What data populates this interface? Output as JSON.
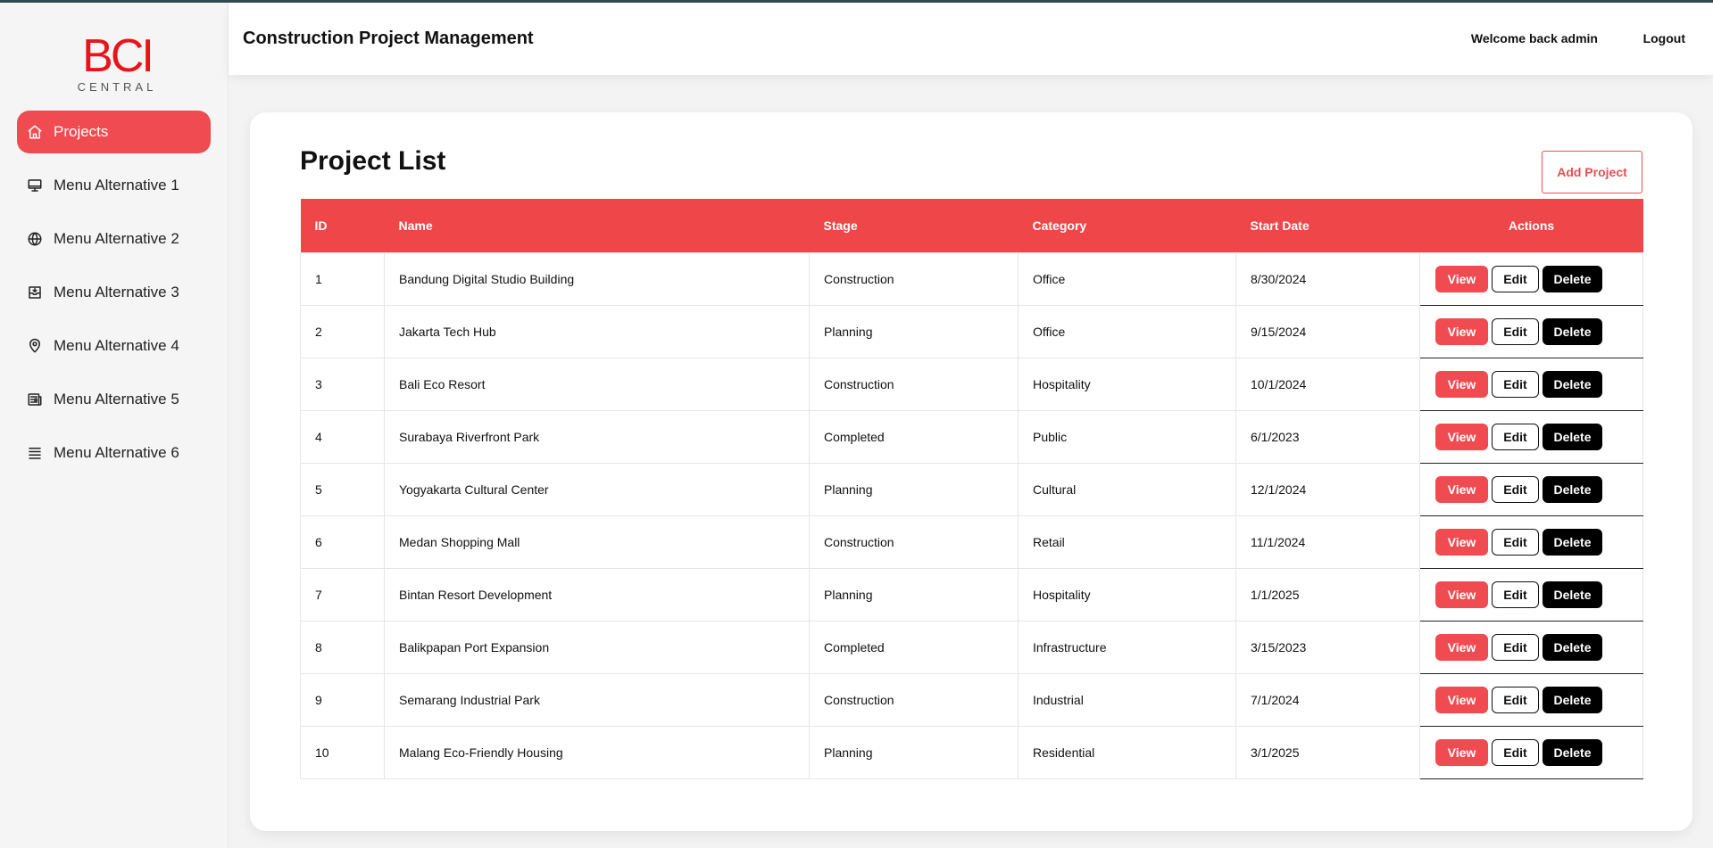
{
  "brand": {
    "logo_mark": "BCI",
    "logo_sub": "CENTRAL",
    "accent": "#ef4b50"
  },
  "sidebar": {
    "items": [
      {
        "label": "Projects",
        "icon": "home-icon",
        "active": true
      },
      {
        "label": "Menu Alternative 1",
        "icon": "monitor-icon"
      },
      {
        "label": "Menu Alternative 2",
        "icon": "globe-icon"
      },
      {
        "label": "Menu Alternative 3",
        "icon": "inbox-icon"
      },
      {
        "label": "Menu Alternative 4",
        "icon": "map-pin-icon"
      },
      {
        "label": "Menu Alternative 5",
        "icon": "newspaper-icon"
      },
      {
        "label": "Menu Alternative 6",
        "icon": "list-icon"
      }
    ]
  },
  "header": {
    "title": "Construction Project Management",
    "welcome": "Welcome back admin",
    "logout": "Logout"
  },
  "main": {
    "title": "Project List",
    "add_button": "Add Project",
    "columns": [
      "ID",
      "Name",
      "Stage",
      "Category",
      "Start Date",
      "Actions"
    ],
    "action_labels": {
      "view": "View",
      "edit": "Edit",
      "delete": "Delete"
    },
    "rows": [
      {
        "id": "1",
        "name": "Bandung Digital Studio Building",
        "stage": "Construction",
        "category": "Office",
        "start_date": "8/30/2024"
      },
      {
        "id": "2",
        "name": "Jakarta Tech Hub",
        "stage": "Planning",
        "category": "Office",
        "start_date": "9/15/2024"
      },
      {
        "id": "3",
        "name": "Bali Eco Resort",
        "stage": "Construction",
        "category": "Hospitality",
        "start_date": "10/1/2024"
      },
      {
        "id": "4",
        "name": "Surabaya Riverfront Park",
        "stage": "Completed",
        "category": "Public",
        "start_date": "6/1/2023"
      },
      {
        "id": "5",
        "name": "Yogyakarta Cultural Center",
        "stage": "Planning",
        "category": "Cultural",
        "start_date": "12/1/2024"
      },
      {
        "id": "6",
        "name": "Medan Shopping Mall",
        "stage": "Construction",
        "category": "Retail",
        "start_date": "11/1/2024"
      },
      {
        "id": "7",
        "name": "Bintan Resort Development",
        "stage": "Planning",
        "category": "Hospitality",
        "start_date": "1/1/2025"
      },
      {
        "id": "8",
        "name": "Balikpapan Port Expansion",
        "stage": "Completed",
        "category": "Infrastructure",
        "start_date": "3/15/2023"
      },
      {
        "id": "9",
        "name": "Semarang Industrial Park",
        "stage": "Construction",
        "category": "Industrial",
        "start_date": "7/1/2024"
      },
      {
        "id": "10",
        "name": "Malang Eco-Friendly Housing",
        "stage": "Planning",
        "category": "Residential",
        "start_date": "3/1/2025"
      }
    ]
  }
}
